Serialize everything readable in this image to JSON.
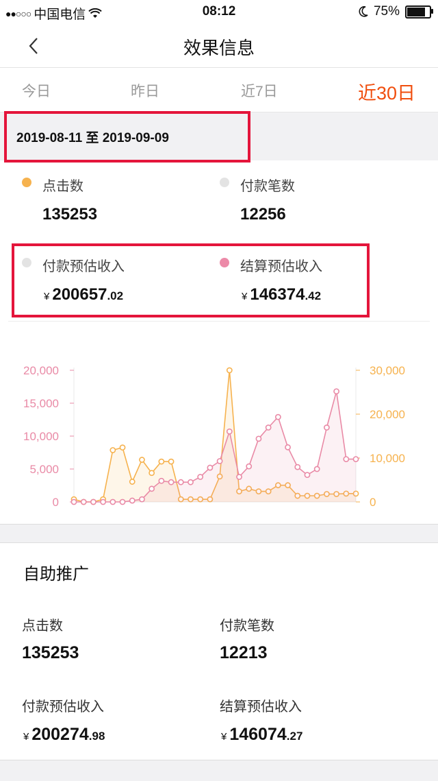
{
  "status_bar": {
    "carrier": "中国电信",
    "time": "08:12",
    "battery": "75%"
  },
  "nav": {
    "title": "效果信息"
  },
  "tabs": [
    {
      "label": "今日",
      "active": false
    },
    {
      "label": "昨日",
      "active": false
    },
    {
      "label": "近7日",
      "active": false
    },
    {
      "label": "近30日",
      "active": true
    }
  ],
  "date_range": "2019-08-11 至 2019-09-09",
  "summary": {
    "clicks": {
      "label": "点击数",
      "value": "135253",
      "color": "#f6b24e"
    },
    "payments": {
      "label": "付款笔数",
      "value": "12256",
      "color": "#e3e3e3"
    },
    "pay_income": {
      "label": "付款预估收入",
      "currency": "¥",
      "int": "200657",
      "dec": ".02",
      "color": "#e3e3e3"
    },
    "settle_income": {
      "label": "结算预估收入",
      "currency": "¥",
      "int": "146374",
      "dec": ".42",
      "color": "#ec8aa8"
    }
  },
  "chart_data": {
    "type": "line",
    "left_axis": {
      "ticks": [
        "20,000",
        "15,000",
        "10,000",
        "5,000",
        "0"
      ],
      "range": [
        0,
        20000
      ],
      "color": "#e98aa6"
    },
    "right_axis": {
      "ticks": [
        "30,000",
        "20,000",
        "10,000",
        "0"
      ],
      "range": [
        0,
        30000
      ],
      "color": "#f6b24e"
    },
    "series": [
      {
        "axis": "right",
        "color": "#f6b24e",
        "values": [
          600,
          0,
          0,
          600,
          11800,
          12400,
          4600,
          9600,
          6600,
          9200,
          9200,
          600,
          600,
          600,
          600,
          5800,
          30000,
          2400,
          3000,
          2400,
          2400,
          3800,
          3800,
          1400,
          1400,
          1400,
          1800,
          1800,
          1900,
          1900
        ]
      },
      {
        "axis": "left",
        "color": "#e98aa6",
        "values": [
          0,
          0,
          0,
          0,
          0,
          0,
          200,
          400,
          2000,
          3200,
          3000,
          3000,
          3000,
          3800,
          5200,
          6200,
          10700,
          3800,
          5400,
          9600,
          11300,
          12900,
          8300,
          5300,
          4100,
          5000,
          11300,
          16800,
          6500,
          6500
        ]
      }
    ]
  },
  "self_promo": {
    "title": "自助推广",
    "clicks": {
      "label": "点击数",
      "value": "135253"
    },
    "payments": {
      "label": "付款笔数",
      "value": "12213"
    },
    "pay_income": {
      "label": "付款预估收入",
      "currency": "¥",
      "int": "200274",
      "dec": ".98"
    },
    "settle_income": {
      "label": "结算预估收入",
      "currency": "¥",
      "int": "146074",
      "dec": ".27"
    }
  }
}
